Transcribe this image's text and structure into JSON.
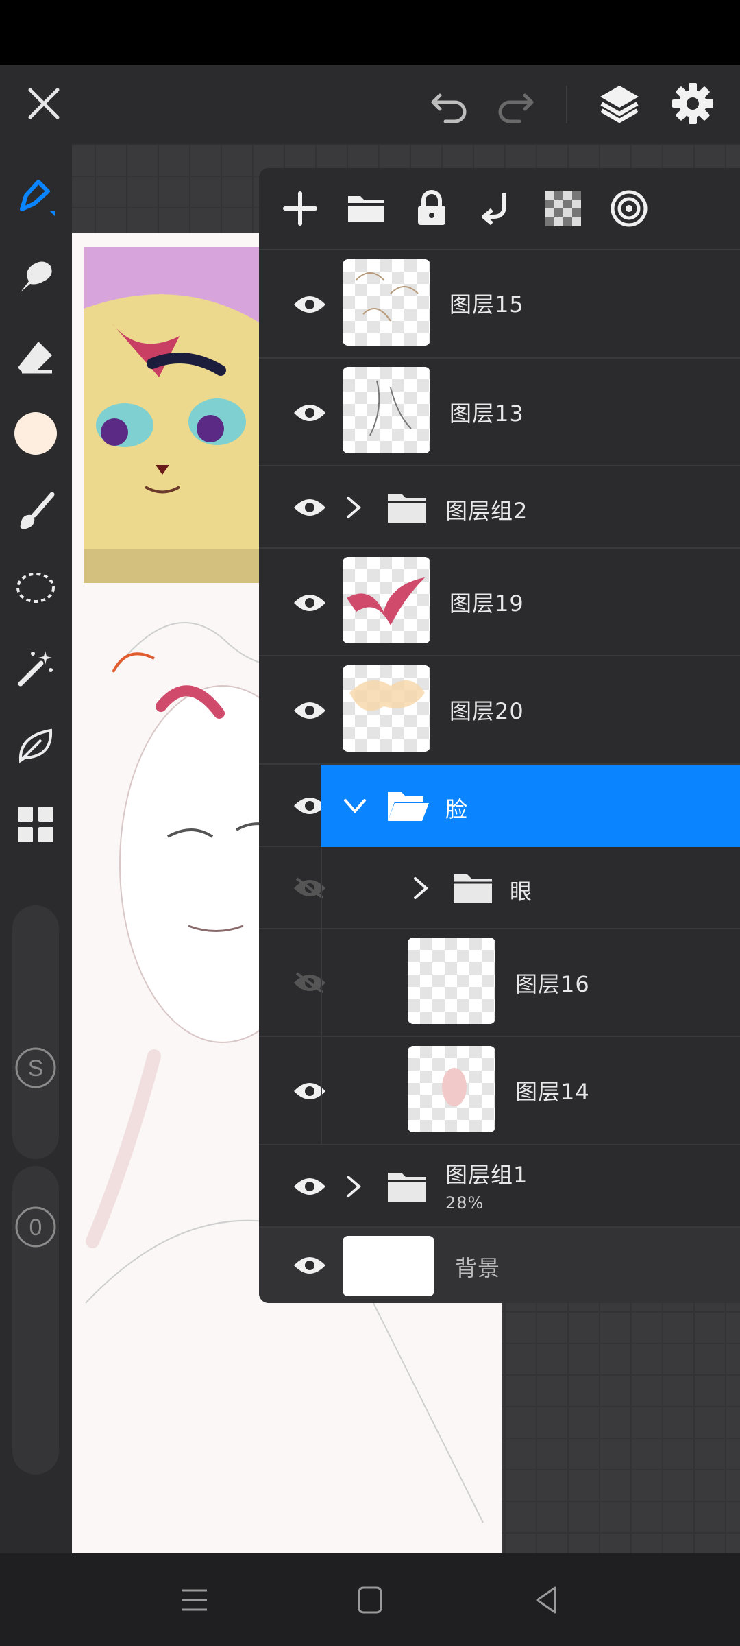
{
  "layers_panel": {
    "layers": [
      {
        "name": "图层15",
        "visible": true,
        "type": "layer"
      },
      {
        "name": "图层13",
        "visible": true,
        "type": "layer"
      },
      {
        "name": "图层组2",
        "visible": true,
        "type": "group",
        "expanded": false
      },
      {
        "name": "图层19",
        "visible": true,
        "type": "layer"
      },
      {
        "name": "图层20",
        "visible": true,
        "type": "layer"
      },
      {
        "name": "脸",
        "visible": true,
        "type": "group",
        "expanded": true,
        "selected": true
      },
      {
        "name": "眼",
        "visible": false,
        "type": "group",
        "expanded": false
      },
      {
        "name": "图层16",
        "visible": false,
        "type": "layer"
      },
      {
        "name": "图层14",
        "visible": true,
        "type": "layer"
      },
      {
        "name": "图层组1",
        "visible": true,
        "type": "group",
        "expanded": false,
        "opacity": "28%"
      },
      {
        "name": "背景",
        "visible": true,
        "type": "background"
      }
    ]
  },
  "colors": {
    "accent": "#0a84ff",
    "current_brush_color": "#fdeee0",
    "panel_bg": "#2b2b2d"
  },
  "icons": {
    "top_left": "close-icon",
    "top_right": [
      "undo-icon",
      "redo-icon",
      "layers-icon",
      "settings-icon"
    ],
    "toolbar": [
      "pen-icon",
      "smudge-icon",
      "eraser-icon",
      "color-swatch",
      "brush-icon",
      "lasso-icon",
      "magic-wand-icon",
      "leaf-icon",
      "grid-icon",
      "s-pen-icon",
      "zero-icon"
    ],
    "panel_header": [
      "add-layer-icon",
      "add-folder-icon",
      "lock-icon",
      "merge-down-icon",
      "alpha-icon",
      "blend-icon"
    ],
    "nav": [
      "menu-icon",
      "home-icon",
      "back-icon"
    ]
  }
}
